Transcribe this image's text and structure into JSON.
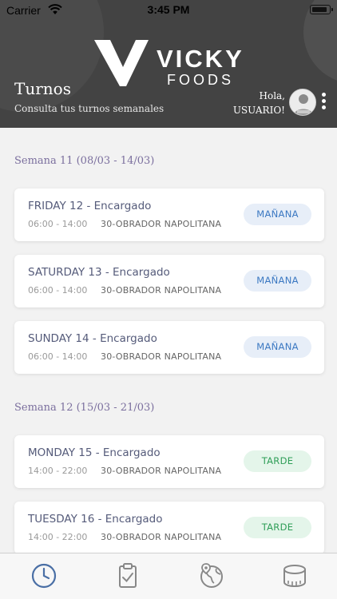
{
  "status_bar": {
    "carrier": "Carrier",
    "time": "3:45 PM"
  },
  "brand": {
    "line1": "VICKY",
    "line2": "FOODS"
  },
  "header": {
    "title": "Turnos",
    "subtitle": "Consulta tus turnos semanales",
    "greeting_line1": "Hola,",
    "greeting_line2": "USUARIO!"
  },
  "weeks": [
    {
      "label": "Semana 11 (08/03 - 14/03)",
      "shifts": [
        {
          "day": "FRIDAY 12 - Encargado",
          "hours": "06:00 - 14:00",
          "place": "30-OBRADOR NAPOLITANA",
          "badge": "MAÑANA"
        },
        {
          "day": "SATURDAY 13 - Encargado",
          "hours": "06:00 - 14:00",
          "place": "30-OBRADOR NAPOLITANA",
          "badge": "MAÑANA"
        },
        {
          "day": "SUNDAY 14 - Encargado",
          "hours": "06:00 - 14:00",
          "place": "30-OBRADOR NAPOLITANA",
          "badge": "MAÑANA"
        }
      ]
    },
    {
      "label": "Semana 12 (15/03 - 21/03)",
      "shifts": [
        {
          "day": "MONDAY 15 - Encargado",
          "hours": "14:00 - 22:00",
          "place": "30-OBRADOR NAPOLITANA",
          "badge": "TARDE"
        },
        {
          "day": "TUESDAY 16 - Encargado",
          "hours": "14:00 - 22:00",
          "place": "30-OBRADOR NAPOLITANA",
          "badge": "TARDE"
        }
      ]
    }
  ],
  "colors": {
    "header_bg": "#434343",
    "week_label": "#7b6f9e",
    "badge_morning_bg": "#e7eef8",
    "badge_morning_text": "#3b78c2",
    "badge_afternoon_bg": "#e4f5ea",
    "badge_afternoon_text": "#2f9e58",
    "tab_active": "#4a6fa5"
  },
  "tabs": [
    {
      "icon": "clock-icon",
      "active": true
    },
    {
      "icon": "clipboard-check-icon",
      "active": false
    },
    {
      "icon": "globe-location-icon",
      "active": false
    },
    {
      "icon": "measuring-tape-icon",
      "active": false
    }
  ]
}
